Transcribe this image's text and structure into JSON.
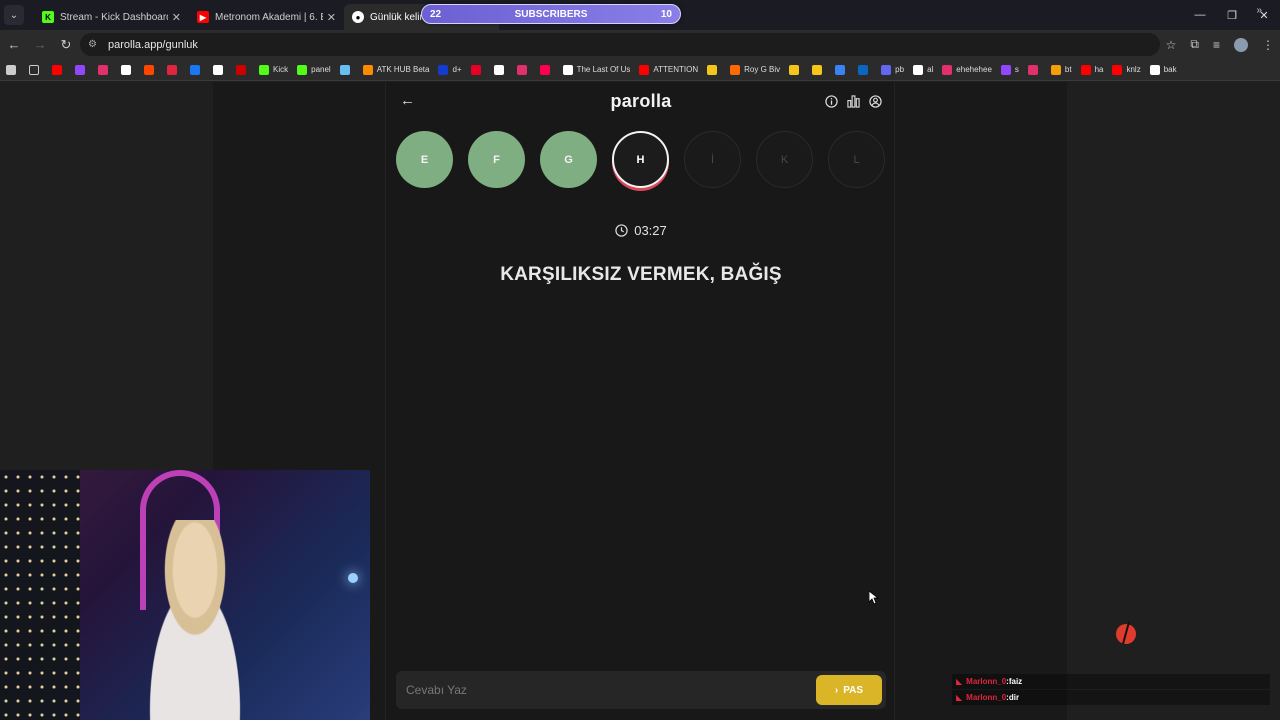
{
  "tabs": [
    {
      "title": "Stream - Kick Dashboard",
      "favicon": "kick-icon",
      "color": "#53fc18"
    },
    {
      "title": "Metronom Akademi | 6. Bölüm",
      "favicon": "youtube-icon",
      "color": "#ff0000"
    },
    {
      "title": "Günlük kelime oyunu",
      "favicon": "parolla-icon",
      "color": "#ffffff"
    }
  ],
  "subscribers": {
    "left": "22",
    "label": "SUBSCRIBERS",
    "right": "10"
  },
  "address": {
    "url": "parolla.app/gunluk"
  },
  "bookmarks": [
    {
      "label": "",
      "color": "#ff0000"
    },
    {
      "label": "",
      "color": "#9146ff"
    },
    {
      "label": "",
      "color": "#e1306c"
    },
    {
      "label": "",
      "color": "#ffffff"
    },
    {
      "label": "",
      "color": "#ff4500"
    },
    {
      "label": "",
      "color": "#e0253f"
    },
    {
      "label": "",
      "color": "#1877f2"
    },
    {
      "label": "",
      "color": "#ffffff"
    },
    {
      "label": "",
      "color": "#cc0000"
    },
    {
      "label": "Kick",
      "color": "#53fc18"
    },
    {
      "label": "panel",
      "color": "#53fc18"
    },
    {
      "label": "",
      "color": "#66c0f4"
    },
    {
      "label": "ATK HUB Beta",
      "color": "#ff8c00"
    },
    {
      "label": "d+",
      "color": "#113ccf"
    },
    {
      "label": "",
      "color": "#e60023"
    },
    {
      "label": "",
      "color": "#ffffff"
    },
    {
      "label": "",
      "color": "#e1306c"
    },
    {
      "label": "",
      "color": "#ff0050"
    },
    {
      "label": "The Last Of Us",
      "color": "#ffffff"
    },
    {
      "label": "ATTENTION",
      "color": "#ff0000"
    },
    {
      "label": "",
      "color": "#f5c518"
    },
    {
      "label": "Roy G Biv",
      "color": "#ff6a00"
    },
    {
      "label": "",
      "color": "#f5c518"
    },
    {
      "label": "",
      "color": "#f5c518"
    },
    {
      "label": "",
      "color": "#3b82f6"
    },
    {
      "label": "",
      "color": "#0a66c2"
    },
    {
      "label": "pb",
      "color": "#6366f1"
    },
    {
      "label": "al",
      "color": "#ffffff"
    },
    {
      "label": "ehehehee",
      "color": "#e1306c"
    },
    {
      "label": "s",
      "color": "#9146ff"
    },
    {
      "label": "",
      "color": "#e1306c"
    },
    {
      "label": "bt",
      "color": "#f59e0b"
    },
    {
      "label": "ha",
      "color": "#ff0000"
    },
    {
      "label": "knlz",
      "color": "#ff0000"
    },
    {
      "label": "bak",
      "color": "#ffffff"
    }
  ],
  "app": {
    "brand": "parolla",
    "letters": [
      {
        "char": "E",
        "state": "done"
      },
      {
        "char": "F",
        "state": "done"
      },
      {
        "char": "G",
        "state": "done"
      },
      {
        "char": "H",
        "state": "current"
      },
      {
        "char": "İ",
        "state": "pending"
      },
      {
        "char": "K",
        "state": "pending"
      },
      {
        "char": "L",
        "state": "pending"
      }
    ],
    "timer": "03:27",
    "clue": "KARŞILIKSIZ VERMEK, BAĞIŞ",
    "answer_placeholder": "Cevabı Yaz",
    "pass_label": "PAS"
  },
  "chat": [
    {
      "user": "Marlonn_0",
      "sep": " : ",
      "msg": "faiz"
    },
    {
      "user": "Marlonn_0",
      "sep": " : ",
      "msg": "dir"
    }
  ],
  "colors": {
    "done": "#7fae82",
    "pass": "#d9b527",
    "current_ring": "#d64a5a"
  }
}
